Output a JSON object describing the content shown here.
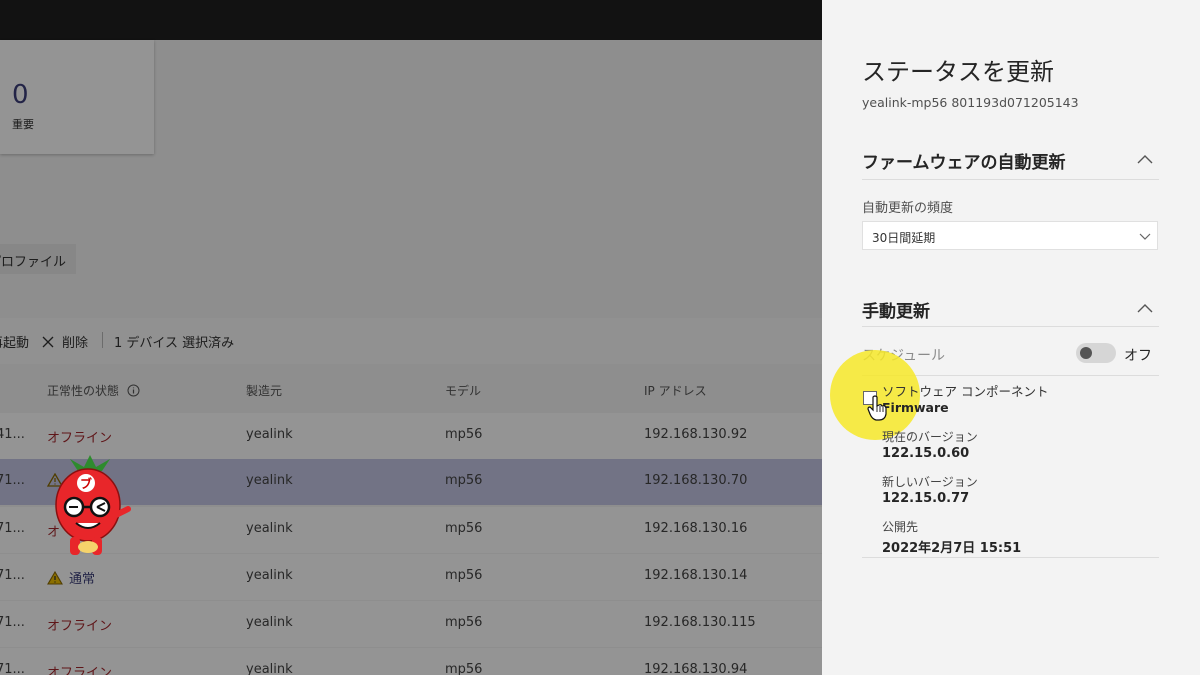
{
  "summary": {
    "count": "0",
    "label": "重要"
  },
  "profile_tab": {
    "label": "プロファイル"
  },
  "toolbar": {
    "item1": "再起動",
    "delete": "削除",
    "selection": "1 デバイス 選択済み"
  },
  "table": {
    "headers": {
      "health": "正常性の状態",
      "manufacturer": "製造元",
      "model": "モデル",
      "ip": "IP アドレス"
    },
    "rows": [
      {
        "id": "41...",
        "status": "オフライン",
        "manufacturer": "yealink",
        "model": "mp56",
        "ip": "192.168.130.92"
      },
      {
        "id": "71...",
        "status": "",
        "manufacturer": "yealink",
        "model": "mp56",
        "ip": "192.168.130.70"
      },
      {
        "id": "71...",
        "status": "オ",
        "manufacturer": "yealink",
        "model": "mp56",
        "ip": "192.168.130.16"
      },
      {
        "id": "71...",
        "status": "通常",
        "manufacturer": "yealink",
        "model": "mp56",
        "ip": "192.168.130.14"
      },
      {
        "id": "71...",
        "status": "オフライン",
        "manufacturer": "yealink",
        "model": "mp56",
        "ip": "192.168.130.115"
      },
      {
        "id": "71...",
        "status": "オフライン",
        "manufacturer": "yealink",
        "model": "mp56",
        "ip": "192.168.130.94"
      }
    ]
  },
  "mascot": {
    "badge": "ブ"
  },
  "panel": {
    "title": "ステータスを更新",
    "subtitle": "yealink-mp56 801193d071205143",
    "auto_update": {
      "title": "ファームウェアの自動更新",
      "frequency_label": "自動更新の頻度",
      "frequency_value": "30日間延期"
    },
    "manual_update": {
      "title": "手動更新",
      "schedule_label": "スケジュール",
      "schedule_state": "オフ",
      "component_label": "ソフトウェア コンポーネント",
      "component_name": "Firmware",
      "current_version_label": "現在のバージョン",
      "current_version": "122.15.0.60",
      "new_version_label": "新しいバージョン",
      "new_version": "122.15.0.77",
      "published_label": "公開先",
      "published_value": "2022年2月7日 15:51"
    }
  },
  "colors": {
    "accent": "#3d3f7a",
    "offline": "#a4262c",
    "highlight": "#f6e828"
  }
}
